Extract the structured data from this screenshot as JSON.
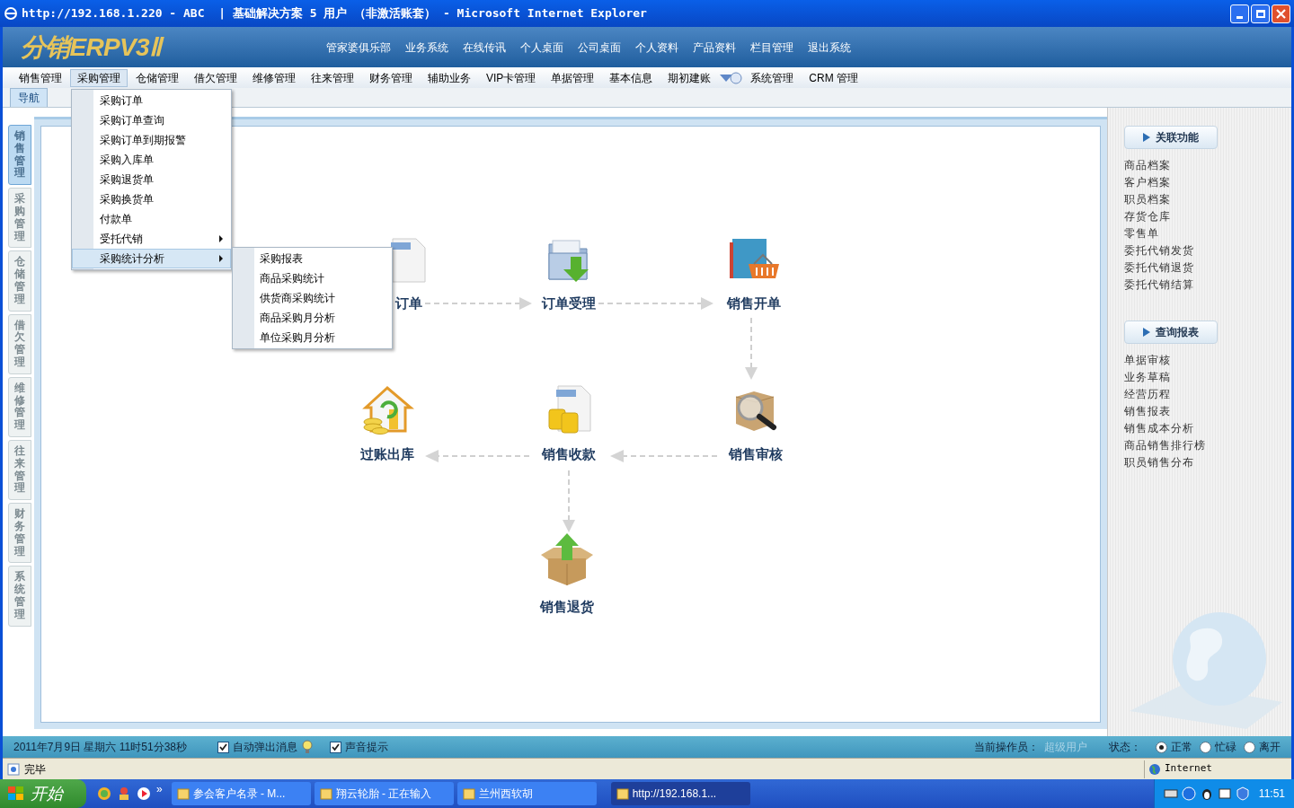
{
  "window": {
    "title": "http://192.168.1.220 - ABC  | 基础解决方案 5 用户 （非激活账套） - Microsoft Internet Explorer"
  },
  "header": {
    "logo": "分销ERPV3Ⅱ",
    "links": [
      "管家婆俱乐部",
      "业务系统",
      "在线传讯",
      "个人桌面",
      "公司桌面",
      "个人资料",
      "产品资料",
      "栏目管理",
      "退出系统"
    ]
  },
  "menubar": {
    "items": [
      {
        "label": "销售管理",
        "selected": false
      },
      {
        "label": "采购管理",
        "selected": true
      },
      {
        "label": "仓储管理",
        "selected": false
      },
      {
        "label": "借欠管理",
        "selected": false
      },
      {
        "label": "维修管理",
        "selected": false
      },
      {
        "label": "往来管理",
        "selected": false
      },
      {
        "label": "财务管理",
        "selected": false
      },
      {
        "label": "辅助业务",
        "selected": false
      },
      {
        "label": "VIP卡管理",
        "selected": false
      },
      {
        "label": "单据管理",
        "selected": false
      },
      {
        "label": "基本信息",
        "selected": false
      },
      {
        "label": "期初建账",
        "selected": false
      },
      {
        "label": "系统管理",
        "selected": false
      },
      {
        "label": "CRM 管理",
        "selected": false
      }
    ]
  },
  "dropdown": {
    "items": [
      {
        "label": "采购订单",
        "has_submenu": false,
        "selected": false
      },
      {
        "label": "采购订单查询",
        "has_submenu": false,
        "selected": false
      },
      {
        "label": "采购订单到期报警",
        "has_submenu": false,
        "selected": false
      },
      {
        "label": "采购入库单",
        "has_submenu": false,
        "selected": false
      },
      {
        "label": "采购退货单",
        "has_submenu": false,
        "selected": false
      },
      {
        "label": "采购换货单",
        "has_submenu": false,
        "selected": false
      },
      {
        "label": "付款单",
        "has_submenu": false,
        "selected": false
      },
      {
        "label": "受托代销",
        "has_submenu": true,
        "selected": false
      },
      {
        "label": "采购统计分析",
        "has_submenu": true,
        "selected": true
      }
    ]
  },
  "submenu": {
    "items": [
      {
        "label": "采购报表",
        "selected": false
      },
      {
        "label": "商品采购统计",
        "selected": false
      },
      {
        "label": "供货商采购统计",
        "selected": false
      },
      {
        "label": "商品采购月分析",
        "selected": false
      },
      {
        "label": "单位采购月分析",
        "selected": false
      }
    ]
  },
  "nav_tab": {
    "label": "导航"
  },
  "side_tabs": [
    {
      "label": "销售管理",
      "selected": true
    },
    {
      "label": "采购管理",
      "selected": false
    },
    {
      "label": "仓储管理",
      "selected": false
    },
    {
      "label": "借欠管理",
      "selected": false
    },
    {
      "label": "维修管理",
      "selected": false
    },
    {
      "label": "往来管理",
      "selected": false
    },
    {
      "label": "财务管理",
      "selected": false
    },
    {
      "label": "系统管理",
      "selected": false
    }
  ],
  "flow": {
    "nodes": [
      {
        "label": "订单"
      },
      {
        "label": "订单受理"
      },
      {
        "label": "销售开单"
      },
      {
        "label": "过账出库"
      },
      {
        "label": "销售收款"
      },
      {
        "label": "销售审核"
      },
      {
        "label": "销售退货"
      }
    ]
  },
  "right_panel": {
    "sections": [
      {
        "title": "关联功能",
        "links": [
          "商品档案",
          "客户档案",
          "职员档案",
          "存货仓库",
          "零售单",
          "委托代销发货",
          "委托代销退货",
          "委托代销结算"
        ]
      },
      {
        "title": "查询报表",
        "links": [
          "单据审核",
          "业务草稿",
          "经营历程",
          "销售报表",
          "销售成本分析",
          "商品销售排行榜",
          "职员销售分布"
        ]
      }
    ]
  },
  "status_bar": {
    "datetime": "2011年7月9日 星期六 11时51分38秒",
    "options": [
      {
        "label": "自动弹出消息",
        "checked": true
      },
      {
        "label": "声音提示",
        "checked": true
      }
    ],
    "operator_label": "当前操作员：",
    "operator": "超级用户",
    "state_label": "状态：",
    "states": [
      {
        "label": "正常",
        "selected": true
      },
      {
        "label": "忙碌",
        "selected": false
      },
      {
        "label": "离开",
        "selected": false
      }
    ]
  },
  "ie_status": {
    "text": "完毕",
    "zone": "Internet"
  },
  "taskbar": {
    "start": "开始",
    "more": "»",
    "tasks": [
      {
        "label": "参会客户名录 - M...",
        "selected": false
      },
      {
        "label": "翔云轮胎 - 正在输入",
        "selected": false
      },
      {
        "label": "兰州西软胡",
        "selected": false
      },
      {
        "label": "http://192.168.1...",
        "selected": true
      }
    ],
    "clock": "11:51"
  }
}
